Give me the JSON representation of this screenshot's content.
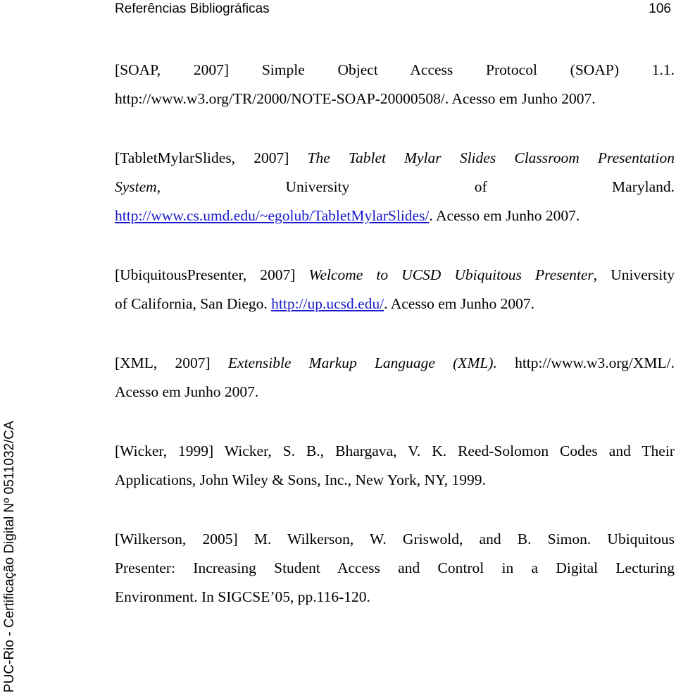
{
  "header": {
    "title": "Referências Bibliográficas",
    "page_number": "106"
  },
  "side_watermark": "PUC-Rio - Certificação Digital Nº 0511032/CA",
  "link_color": "#1a1acc",
  "references": [
    {
      "key": "[SOAP, 2007]",
      "line1": "[SOAP, 2007] Simple Object Access Protocol (SOAP) 1.1.",
      "url": "http://www.w3.org/TR/2000/NOTE-SOAP-20000508/",
      "access": ". Acesso em Junho 2007."
    },
    {
      "key": "[TabletMylarSlides, 2007]",
      "title_line1": "The Tablet Mylar Slides Classroom Presentation",
      "title_line2": "System,",
      "publisher_words": [
        "University",
        "of",
        "Maryland."
      ],
      "url": "http://www.cs.umd.edu/~egolub/TabletMylarSlides/",
      "access": ". Acesso em Junho 2007."
    },
    {
      "key": "[UbiquitousPresenter, 2007]",
      "title": "Welcome to UCSD Ubiquitous Presenter",
      "publisher_a": ", University",
      "publisher_b": "of California, San Diego. ",
      "url": "http://up.ucsd.edu/",
      "access": ". Acesso em Junho 2007."
    },
    {
      "key": "[XML, 2007]",
      "title": "Extensible Markup Language (XML).",
      "url": "http://www.w3.org/XML/.",
      "access": "Acesso em Junho 2007."
    },
    {
      "key": "[Wicker, 1999]",
      "text_line1": "Wicker, S. B., Bhargava, V. K. Reed-Solomon Codes and Their",
      "text_line2": "Applications, John Wiley & Sons, Inc., New York, NY, 1999."
    },
    {
      "key": "[Wilkerson, 2005]",
      "text_line1": "M. Wilkerson, W. Griswold, and B. Simon. Ubiquitous",
      "text_line2": "Presenter: Increasing Student Access and Control in a Digital Lecturing",
      "text_line3": "Environment. In SIGCSE’05, pp.116-120."
    }
  ]
}
